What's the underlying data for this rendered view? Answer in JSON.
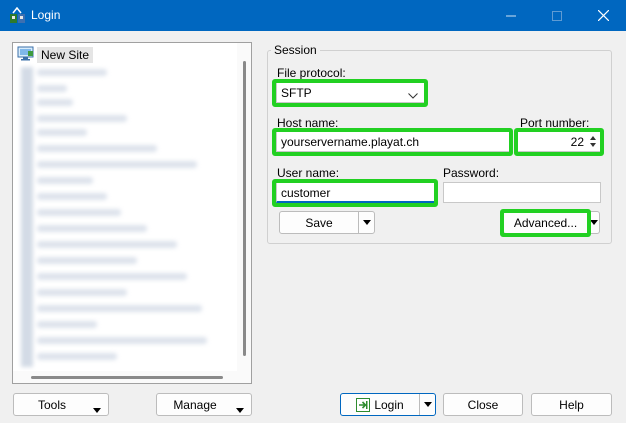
{
  "window": {
    "title": "Login"
  },
  "tree": {
    "root_label": "New Site"
  },
  "session": {
    "legend": "Session",
    "file_protocol_label": "File protocol:",
    "file_protocol_value": "SFTP",
    "host_name_label": "Host name:",
    "host_name_value": "yourservername.playat.ch",
    "port_label": "Port number:",
    "port_value": "22",
    "user_name_label": "User name:",
    "user_name_value": "customer",
    "password_label": "Password:",
    "password_value": "",
    "save_label": "Save",
    "advanced_label": "Advanced..."
  },
  "footer": {
    "tools_label": "Tools",
    "manage_label": "Manage",
    "login_label": "Login",
    "close_label": "Close",
    "help_label": "Help"
  },
  "colors": {
    "titlebar": "#0067c0",
    "highlight": "#22d022",
    "accent": "#0067c0"
  },
  "icons": {
    "app": "winscp-logo-icon",
    "site": "monitor-icon",
    "login": "login-arrow-icon"
  }
}
